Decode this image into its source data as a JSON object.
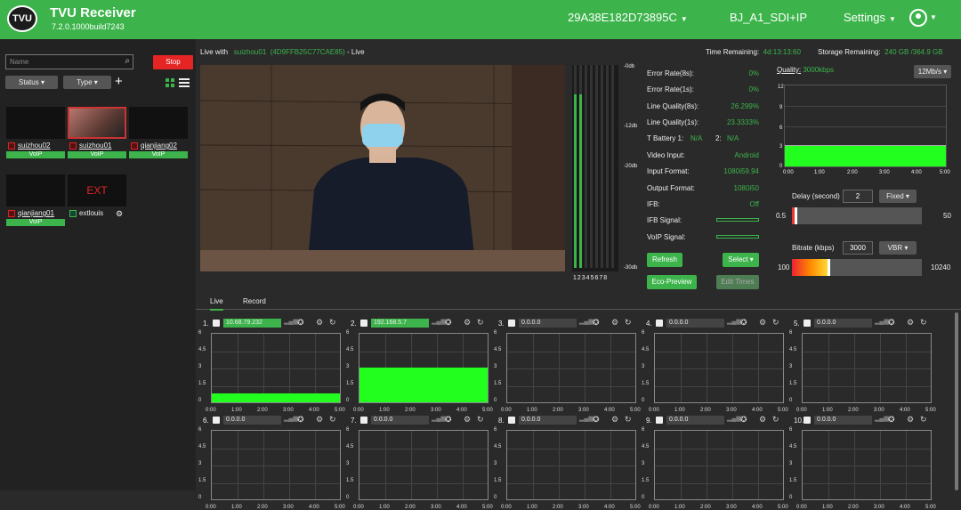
{
  "header": {
    "logo": "TVU",
    "app_name": "TVU Receiver",
    "version": "7.2.0.1000build7243",
    "device_id": "29A38E182D73895C",
    "channel": "BJ_A1_SDI+IP",
    "settings": "Settings"
  },
  "sidebar": {
    "search_placeholder": "Name",
    "stop_label": "Stop",
    "status_label": "Status",
    "type_label": "Type",
    "sources": [
      {
        "name": "suizhou02",
        "tag": "VoIP"
      },
      {
        "name": "suizhou01",
        "tag": "VoIP"
      },
      {
        "name": "qianjiang02",
        "tag": "VoIP"
      },
      {
        "name": "qianjiang01",
        "tag": "VoIP"
      },
      {
        "name": "extlouis",
        "tag": "EXT"
      }
    ]
  },
  "live": {
    "live_with_label": "Live with",
    "source": "suizhou01",
    "source_id": "(4D9FFB25C77CAE85)",
    "status": "- Live",
    "time_remaining_label": "Time Remaining:",
    "time_remaining": "4d:13:13:60",
    "storage_label": "Storage Remaining:",
    "storage": "240 GB /364.9 GB",
    "meter_labels": [
      "-0db",
      "-12db",
      "-20db",
      "-30db"
    ],
    "meter_channels": "12345678",
    "meter_levels": [
      0.84,
      0.84,
      0.0,
      0.0,
      0.0,
      0.0,
      0.0,
      0.0
    ]
  },
  "stats": [
    {
      "label": "Error Rate(8s):",
      "value": "0%"
    },
    {
      "label": "Error Rate(1s):",
      "value": "0%"
    },
    {
      "label": "Line Quality(8s):",
      "value": "26.299%"
    },
    {
      "label": "Line Quality(1s):",
      "value": "23.3333%"
    }
  ],
  "battery": {
    "label": "T Battery 1:",
    "v1": "N/A",
    "label2": "2:",
    "v2": "N/A"
  },
  "inputs": [
    {
      "label": "Video Input:",
      "value": "Android"
    },
    {
      "label": "Input Format:",
      "value": "1080i59.94"
    },
    {
      "label": "Output Format:",
      "value": "1080i50"
    },
    {
      "label": "IFB:",
      "value": "Off"
    },
    {
      "label": "IFB Signal:",
      "value": ""
    },
    {
      "label": "VoIP Signal:",
      "value": ""
    }
  ],
  "buttons": {
    "refresh": "Refresh",
    "select": "Select",
    "eco": "Eco-Preview",
    "edit": "Edit Times"
  },
  "quality": {
    "label": "Quality:",
    "value": "3000kbps",
    "rate": "12Mb/s",
    "y_ticks": [
      "12",
      "9",
      "6",
      "3",
      "0"
    ],
    "x_ticks": [
      "0:00",
      "1:00",
      "2:00",
      "3:00",
      "4:00",
      "5:00"
    ],
    "level": 3
  },
  "delay": {
    "label": "Delay (second)",
    "value": "2",
    "mode": "Fixed",
    "min": "0.5",
    "max": "50"
  },
  "bitrate": {
    "label": "Bitrate (kbps)",
    "value": "3000",
    "mode": "VBR",
    "min": "100",
    "max": "10240"
  },
  "tabs": [
    "Live",
    "Record"
  ],
  "panels": [
    {
      "n": "1.",
      "ip": "10.68.79.232",
      "on": true
    },
    {
      "n": "2.",
      "ip": "192.168.5.7",
      "on": true
    },
    {
      "n": "3.",
      "ip": "0.0.0.0",
      "on": false
    },
    {
      "n": "4.",
      "ip": "0.0.0.0",
      "on": false
    },
    {
      "n": "5.",
      "ip": "0.0.0.0",
      "on": false
    },
    {
      "n": "6.",
      "ip": "0.0.0.0",
      "on": false
    },
    {
      "n": "7.",
      "ip": "0.0.0.0",
      "on": false
    },
    {
      "n": "8.",
      "ip": "0.0.0.0",
      "on": false
    },
    {
      "n": "9.",
      "ip": "0.0.0.0",
      "on": false
    },
    {
      "n": "10.",
      "ip": "0.0.0.0",
      "on": false
    }
  ],
  "panel_y_ticks": [
    "6",
    "4.5",
    "3",
    "1.5",
    "0"
  ],
  "panel_x_ticks": [
    "0:00",
    "1:00",
    "2:00",
    "3:00",
    "4:00",
    "5:00"
  ],
  "panel_levels": [
    0.8,
    3.0,
    0,
    0,
    0,
    0,
    0,
    0,
    0,
    0
  ]
}
